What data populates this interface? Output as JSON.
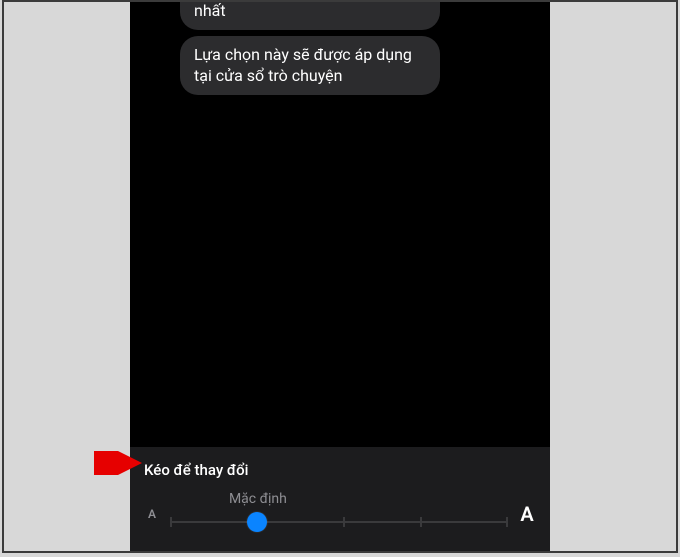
{
  "messages": {
    "bubble1": "nhất",
    "bubble2": "Lựa chọn này sẽ được áp dụng tại cửa sổ trò chuyện"
  },
  "panel": {
    "drag_label": "Kéo để thay đổi",
    "small_a": "A",
    "large_a": "A",
    "default_label": "Mặc định"
  },
  "slider": {
    "steps": 5,
    "value_index": 1,
    "thumb_color": "#0a84ff"
  }
}
